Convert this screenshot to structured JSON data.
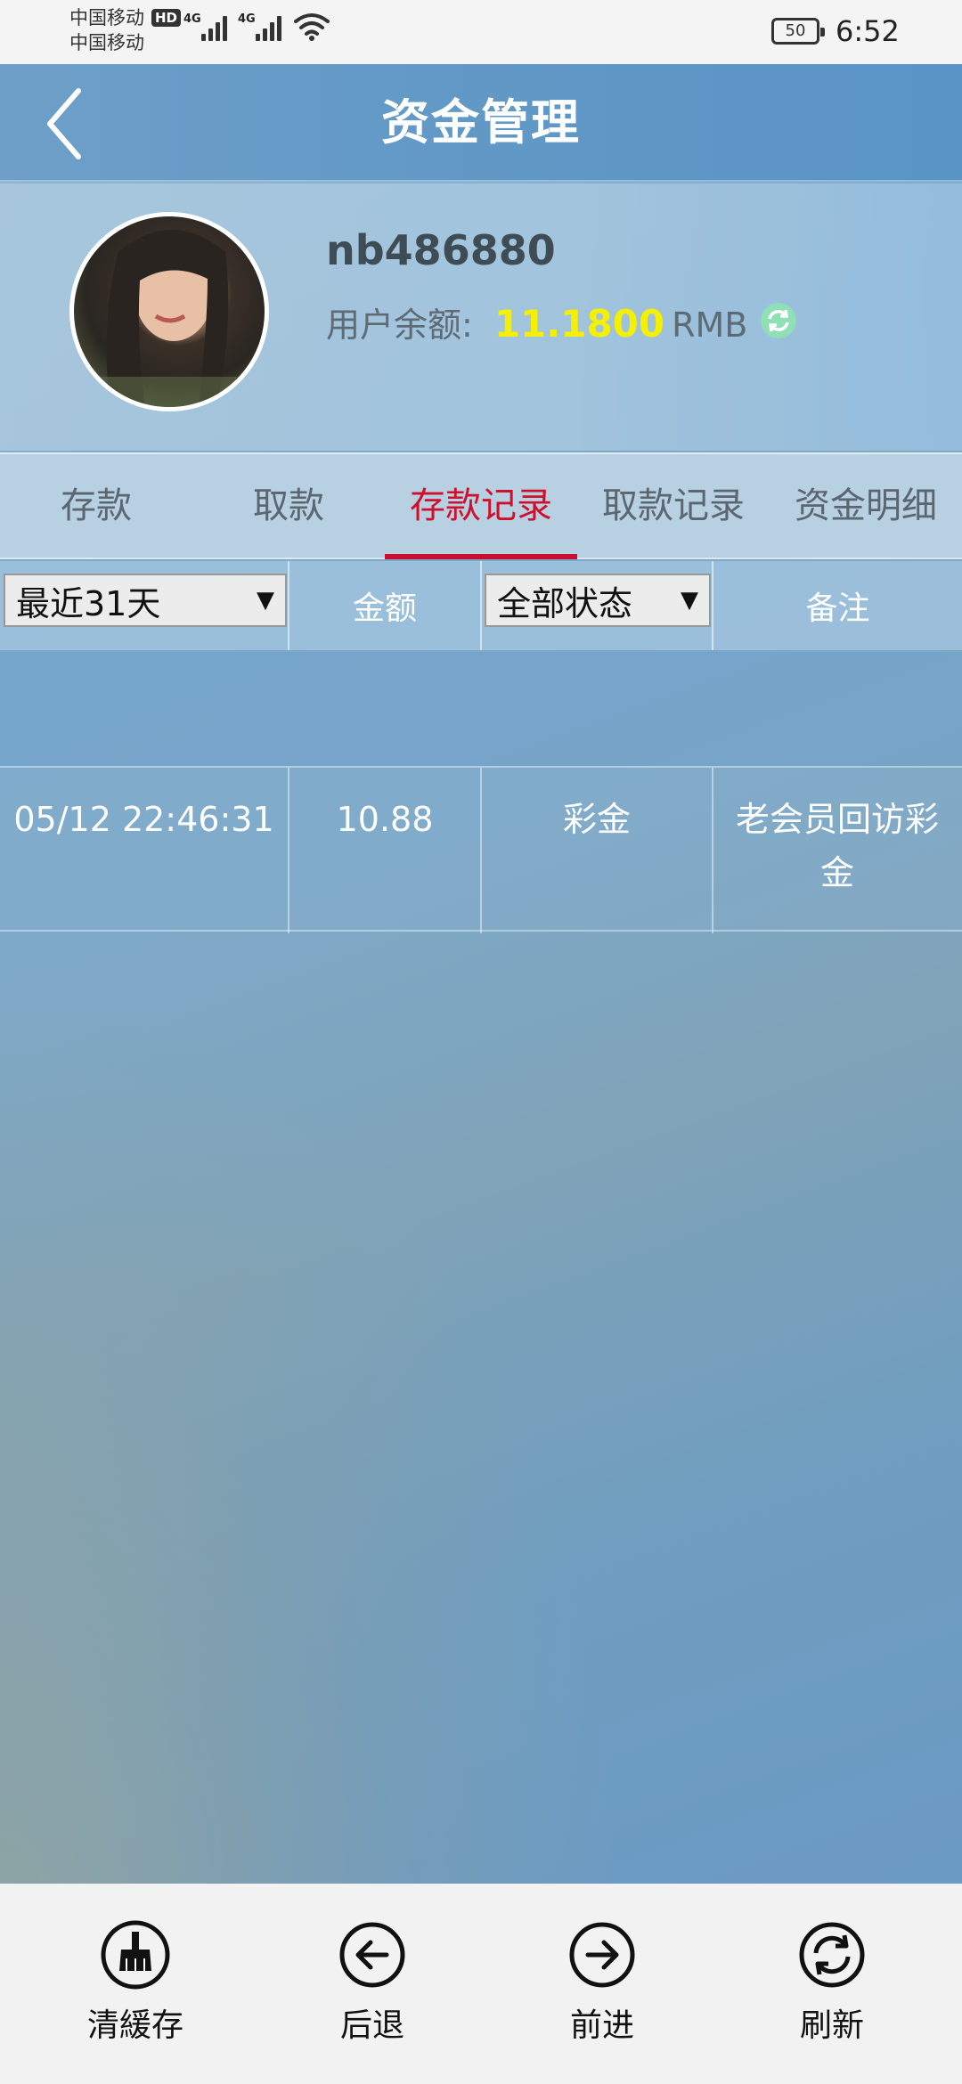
{
  "status_bar": {
    "carrier1": "中国移动",
    "hd_badge": "HD",
    "carrier2": "中国移动",
    "network1": "4G",
    "network2": "4G",
    "battery": "50",
    "time": "6:52"
  },
  "header": {
    "title": "资金管理"
  },
  "profile": {
    "username": "nb486880",
    "balance_label": "用户余额:",
    "balance_value": "11.1800",
    "currency": "RMB"
  },
  "tabs": [
    {
      "label": "存款",
      "active": false
    },
    {
      "label": "取款",
      "active": false
    },
    {
      "label": "存款记录",
      "active": true
    },
    {
      "label": "取款记录",
      "active": false
    },
    {
      "label": "资金明细",
      "active": false
    }
  ],
  "table": {
    "date_filter": "最近31天",
    "amount_header": "金额",
    "status_filter": "全部状态",
    "note_header": "备注",
    "rows": [
      {
        "time": "05/12 22:46:31",
        "amount": "10.88",
        "status": "彩金",
        "note": "老会员回访彩金"
      }
    ]
  },
  "bottom_bar": {
    "clear_cache": "清緩存",
    "back": "后退",
    "forward": "前进",
    "refresh": "刷新"
  },
  "colors": {
    "accent": "#c8102e",
    "balance": "#f5f000",
    "header": "#5f97c6"
  }
}
